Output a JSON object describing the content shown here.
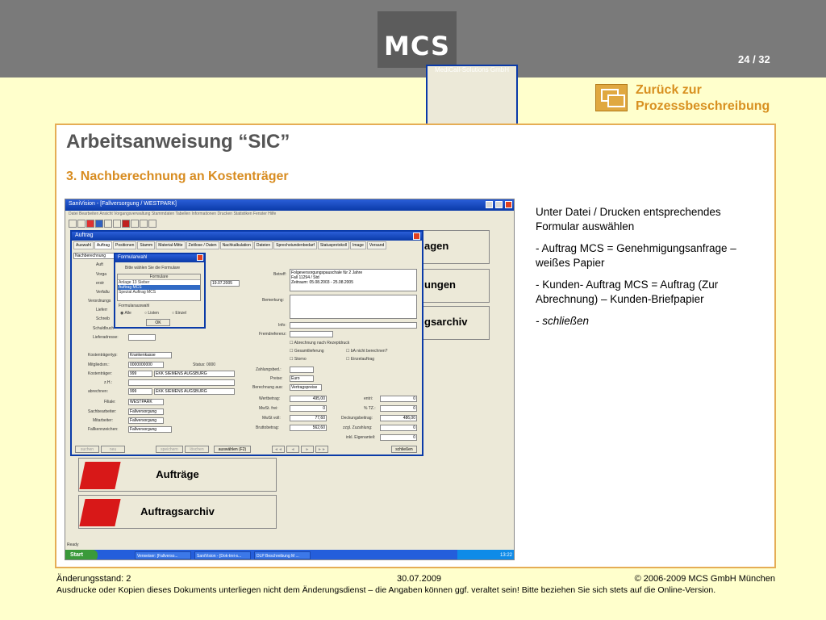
{
  "header": {
    "logo": "MCS",
    "logo_sub": "MediCall-Solutions GmbH",
    "page": "24 / 32"
  },
  "back_link": {
    "line1": "Zurück zur",
    "line2": "Prozessbeschreibung"
  },
  "title": "Arbeitsanweisung “SIC”",
  "subtitle": "3. Nachberechnung an Kostenträger",
  "instructions": [
    "Unter Datei / Drucken  entsprechendes Formular auswählen",
    "- Auftrag MCS = Genehmigungsanfrage – weißes Papier",
    "- Kunden- Auftrag MCS = Auftrag (Zur Abrechnung) – Kunden-Briefpapier",
    "- schließen"
  ],
  "screenshot": {
    "window_title": "SaniVision - [Fallversorgung / WESTPARK]",
    "menu": "Datei  Bearbeiten  Ansicht  Vorgangsverwaltung  Stammdaten  Tabellen  Informationen  Drucken  Statistiken  Fenster  Hilfe",
    "buttons": {
      "auftraege": "Aufträge",
      "auftragsarchiv": "Auftragsarchiv",
      "partial1": "agen",
      "partial2": "ungen",
      "partial3": "gsarchiv"
    },
    "dialog": {
      "title": "Auftrag",
      "tabs": [
        "Auswahl",
        "Auftrag",
        "Positionen",
        "Stamm",
        "Material-Mitte",
        "Zeitlose / Daten",
        "Nachkalkulation",
        "Dateien",
        "Sprechstundenbedarf",
        "Statusprotokoll",
        "Image",
        "Versand"
      ],
      "nachberechnung": "Nachberechnung",
      "left_labels": [
        "Auft",
        "Vorga",
        "erstr",
        "Verfallu",
        "Verordnungs",
        "Lieferr",
        "Schreib",
        "",
        "Schuldbuch",
        "Lieferadresse:",
        "",
        "Kostenträgertyp:",
        "Mitgliedsnr.:",
        "Kostenträger:",
        "z.H.:",
        "abrechnen:",
        "",
        "Filiale:",
        "Sachbearbeiter:",
        "Mitarbeiter:",
        "Fallkennzeichen:"
      ],
      "left_values": [
        "",
        "",
        "",
        "",
        "",
        "",
        "",
        "",
        "",
        "",
        "",
        "Krankenkasse",
        "0000000000",
        "999",
        "",
        "999",
        "",
        "WESTPARK",
        "Fallversorgung",
        "Fallversorgung",
        "Fallversorgung"
      ],
      "right_values": [
        "",
        "",
        "",
        "",
        "",
        "",
        "",
        "",
        "",
        "",
        "",
        "",
        "Status: 0000",
        "EKK SIEMENS AUGSBURG",
        "",
        "EKK SIEMENS AUGSBURG"
      ],
      "date": "19.07.2005",
      "betreff_label": "Betreff:",
      "betreff": "Folgeversorgungspauschale für 2 Jahre\nFall 11294 / Std\nZeitraum: 05.08.2003 - 25.08.2005",
      "bemerkung": "Bemerkung:",
      "info": "Info:",
      "fremdreferenz": "Fremdreferenz:",
      "checks": [
        "Abrechnung nach Rezeptdruck",
        "Gesamtlieferung",
        "bA nicht berechnen?",
        "Storno",
        "Einzelauftrag"
      ],
      "zahlung": "Zahlungsbed.:",
      "preise": "Preise:",
      "preise_val": "Euro",
      "berechnung": "Berechnung aus:",
      "berechnung_val": "Vertragspreise",
      "totals": [
        [
          "Wertbetrag:",
          "495,00",
          "entri:",
          "0"
        ],
        [
          "MwSt. frei:",
          "0",
          "% TZ.:",
          "0"
        ],
        [
          "MwSt voll:",
          "77,60",
          "Deckungsbeitrag:",
          "486,00"
        ],
        [
          "Bruttobetrag:",
          "562,60",
          "zzgl. Zuzahlung:",
          "0"
        ],
        [
          "",
          "",
          "inkl. Eigenanteil:",
          "0"
        ]
      ],
      "bottom_buttons": [
        "suchen",
        "neu",
        "speichern",
        "löschen",
        "auswählen (F2)",
        "schließen"
      ],
      "nav_arrows": [
        "◄◄",
        "◄",
        "►",
        "►►"
      ]
    },
    "sub_dialog": {
      "title": "Formularwahl",
      "prompt": "Bitte wählen Sie die Formulare",
      "list_header": "Formulare",
      "items": [
        "Anlage 13 Sieber",
        "Auftrag MCS",
        "Spezial Auftrag MCS"
      ],
      "selected": 1,
      "group": "Formularauswahl",
      "radios": [
        "Alle",
        "Listen",
        "Einzel"
      ],
      "ok": "OK"
    },
    "status": "Ready",
    "taskbar": {
      "start": "Start",
      "tasks": [
        "Verweiser: [Fallverso...",
        "SaniVision - [Dok-trei-s...",
        "DLP Beschreibung M ..."
      ],
      "clock": "13:22"
    }
  },
  "footer": {
    "left": "Änderungsstand: 2",
    "center": "30.07.2009",
    "right": "© 2006-2009 MCS GmbH München",
    "line2": "Ausdrucke oder Kopien dieses Dokuments unterliegen nicht dem Änderungsdienst – die Angaben können ggf. veraltet sein! Bitte beziehen Sie sich stets auf die Online-Version."
  },
  "colors": {
    "header": "#7a7a7a",
    "background": "#ffffcc",
    "accent": "#d88c20",
    "panel_border": "#e5ad55"
  }
}
